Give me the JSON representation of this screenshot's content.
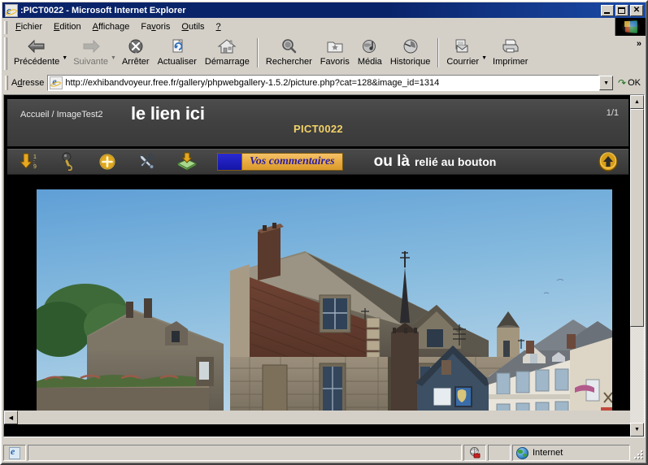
{
  "window": {
    "title": ":PICT0022 - Microsoft Internet Explorer",
    "icon": "ie-document-icon",
    "minimize_label": "_",
    "maximize_label": "□",
    "close_label": "✕"
  },
  "menu": {
    "items": [
      {
        "label": "Fichier",
        "accel": "F"
      },
      {
        "label": "Edition",
        "accel": "E"
      },
      {
        "label": "Affichage",
        "accel": "A"
      },
      {
        "label": "Favoris",
        "accel": "v"
      },
      {
        "label": "Outils",
        "accel": "O"
      },
      {
        "label": "?",
        "accel": "?"
      }
    ]
  },
  "toolbar": {
    "buttons": [
      {
        "label": "Précédente",
        "icon": "back-arrow-icon",
        "disabled": false,
        "dropdown": true
      },
      {
        "label": "Suivante",
        "icon": "forward-arrow-icon",
        "disabled": true,
        "dropdown": true
      },
      {
        "label": "Arrêter",
        "icon": "stop-icon",
        "disabled": false,
        "dropdown": false
      },
      {
        "label": "Actualiser",
        "icon": "refresh-icon",
        "disabled": false,
        "dropdown": false
      },
      {
        "label": "Démarrage",
        "icon": "home-icon",
        "disabled": false,
        "dropdown": false
      },
      {
        "label": "Rechercher",
        "icon": "search-icon",
        "disabled": false,
        "dropdown": false
      },
      {
        "label": "Favoris",
        "icon": "favorites-icon",
        "disabled": false,
        "dropdown": false
      },
      {
        "label": "Média",
        "icon": "media-icon",
        "disabled": false,
        "dropdown": false
      },
      {
        "label": "Historique",
        "icon": "history-icon",
        "disabled": false,
        "dropdown": false
      },
      {
        "label": "Courrier",
        "icon": "mail-icon",
        "disabled": false,
        "dropdown": true
      },
      {
        "label": "Imprimer",
        "icon": "print-icon",
        "disabled": false,
        "dropdown": false
      }
    ],
    "overflow_label": "»"
  },
  "address": {
    "label": "Adresse",
    "url": "http://exhibandvoyeur.free.fr/gallery/phpwebgallery-1.5.2/picture.php?cat=128&image_id=1314",
    "dropdown_glyph": "▼",
    "go_label": "OK",
    "go_glyph": "↷"
  },
  "gallery": {
    "breadcrumb": "Accueil / ImageTest2",
    "headline": "le lien ici",
    "picture_title": "PICT0022",
    "counter": "1/1",
    "actions": [
      {
        "name": "sort-order-icon",
        "title": "trier"
      },
      {
        "name": "slideshow-icon",
        "title": "diaporama"
      },
      {
        "name": "add-icon",
        "title": "ajouter"
      },
      {
        "name": "tools-icon",
        "title": "outils"
      },
      {
        "name": "download-icon",
        "title": "télécharger"
      }
    ],
    "comment_button": "Vos commentaires",
    "note_big": "ou là",
    "note_small": "relié au bouton",
    "up_button": "up-arrow-icon",
    "photo_alt": "Maison médiévale en pierre et maisons à colombages, ciel bleu"
  },
  "scrollbars": {
    "v_up": "▲",
    "v_down": "▼",
    "h_left": "◀",
    "h_right": "▶"
  },
  "status": {
    "message": "",
    "zone": "Internet",
    "zone_icon": "internet-zone-globe-icon",
    "security_icon": "security-lock-icon",
    "doc_icon": "ie-page-icon"
  },
  "colors": {
    "titlebar": "#0a246a",
    "chrome": "#d4d0c8",
    "gallery_bg": "#3f3f3f",
    "page_bg": "#000000",
    "accent_yellow": "#f2d169",
    "comment_orange": "#e8a93f",
    "comment_blue": "#2b1fa0"
  }
}
